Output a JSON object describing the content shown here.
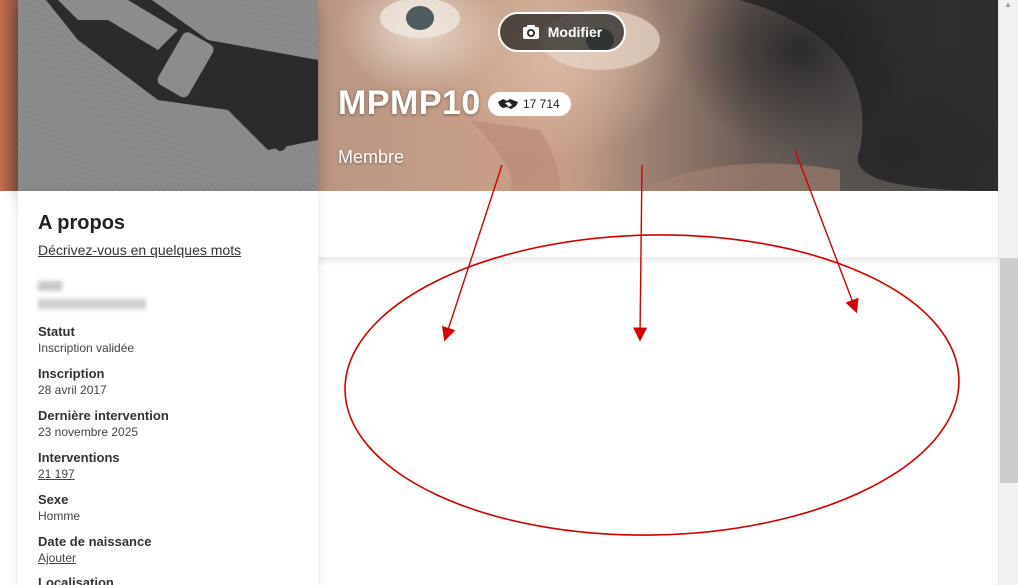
{
  "header": {
    "modify_label": "Modifier",
    "username": "MPMP10",
    "points": "17 714",
    "role": "Membre"
  },
  "about": {
    "title": "A propos",
    "describe_link": "Décrivez-vous en quelques mots",
    "fields": [
      {
        "label": "Statut",
        "value": "Inscription validée",
        "link": false
      },
      {
        "label": "Inscription",
        "value": "28 avril 2017",
        "link": false
      },
      {
        "label": "Dernière intervention",
        "value": "23 novembre 2025",
        "link": false
      },
      {
        "label": "Interventions",
        "value": "21 197",
        "link": true
      },
      {
        "label": "Sexe",
        "value": "Homme",
        "link": false
      },
      {
        "label": "Date de naissance",
        "value": "Ajouter",
        "link": true
      },
      {
        "label": "Localisation",
        "value": "",
        "link": false
      }
    ]
  },
  "colors": {
    "annotation_red": "#d40000",
    "accent_text": "#222222"
  },
  "icons": {
    "modify": "camera-icon",
    "points": "handshake-icon",
    "scroll_up": "chevron-up-icon"
  }
}
